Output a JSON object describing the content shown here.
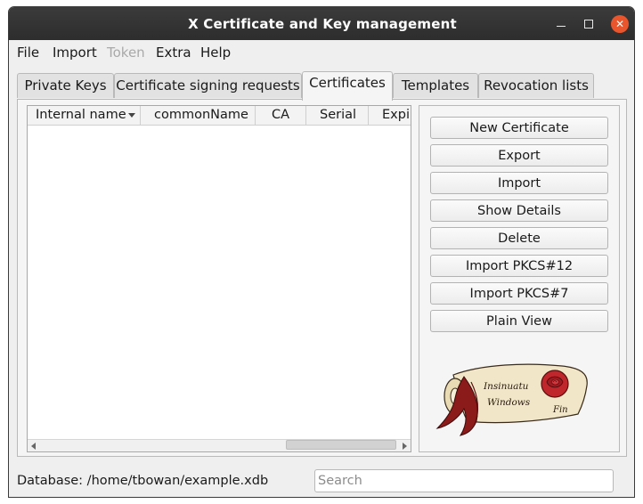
{
  "window": {
    "title": "X Certificate and Key management"
  },
  "menu": [
    {
      "label": "File",
      "enabled": true
    },
    {
      "label": "Import",
      "enabled": true
    },
    {
      "label": "Token",
      "enabled": false
    },
    {
      "label": "Extra",
      "enabled": true
    },
    {
      "label": "Help",
      "enabled": true
    }
  ],
  "tabs": [
    {
      "label": "Private Keys",
      "active": false
    },
    {
      "label": "Certificate signing requests",
      "active": false
    },
    {
      "label": "Certificates",
      "active": true
    },
    {
      "label": "Templates",
      "active": false
    },
    {
      "label": "Revocation lists",
      "active": false
    }
  ],
  "table": {
    "columns": [
      "Internal name",
      "commonName",
      "CA",
      "Serial",
      "Expiry"
    ],
    "rows": []
  },
  "buttons": [
    {
      "label": "New Certificate"
    },
    {
      "label": "Export"
    },
    {
      "label": "Import"
    },
    {
      "label": "Show Details"
    },
    {
      "label": "Delete"
    },
    {
      "label": "Import PKCS#12"
    },
    {
      "label": "Import PKCS#7"
    },
    {
      "label": "Plain View"
    }
  ],
  "logo": {
    "line1": "Insinuatu",
    "line2": "Windows",
    "line3": "Fin"
  },
  "status": {
    "database": "Database: /home/tbowan/example.xdb",
    "search_placeholder": "Search"
  },
  "colors": {
    "titlebar": "#2d2d2d",
    "close_button": "#e9552c",
    "logo_ribbon": "#8b1a1a",
    "logo_rose": "#c0272d",
    "parchment": "#f1e7c8"
  }
}
